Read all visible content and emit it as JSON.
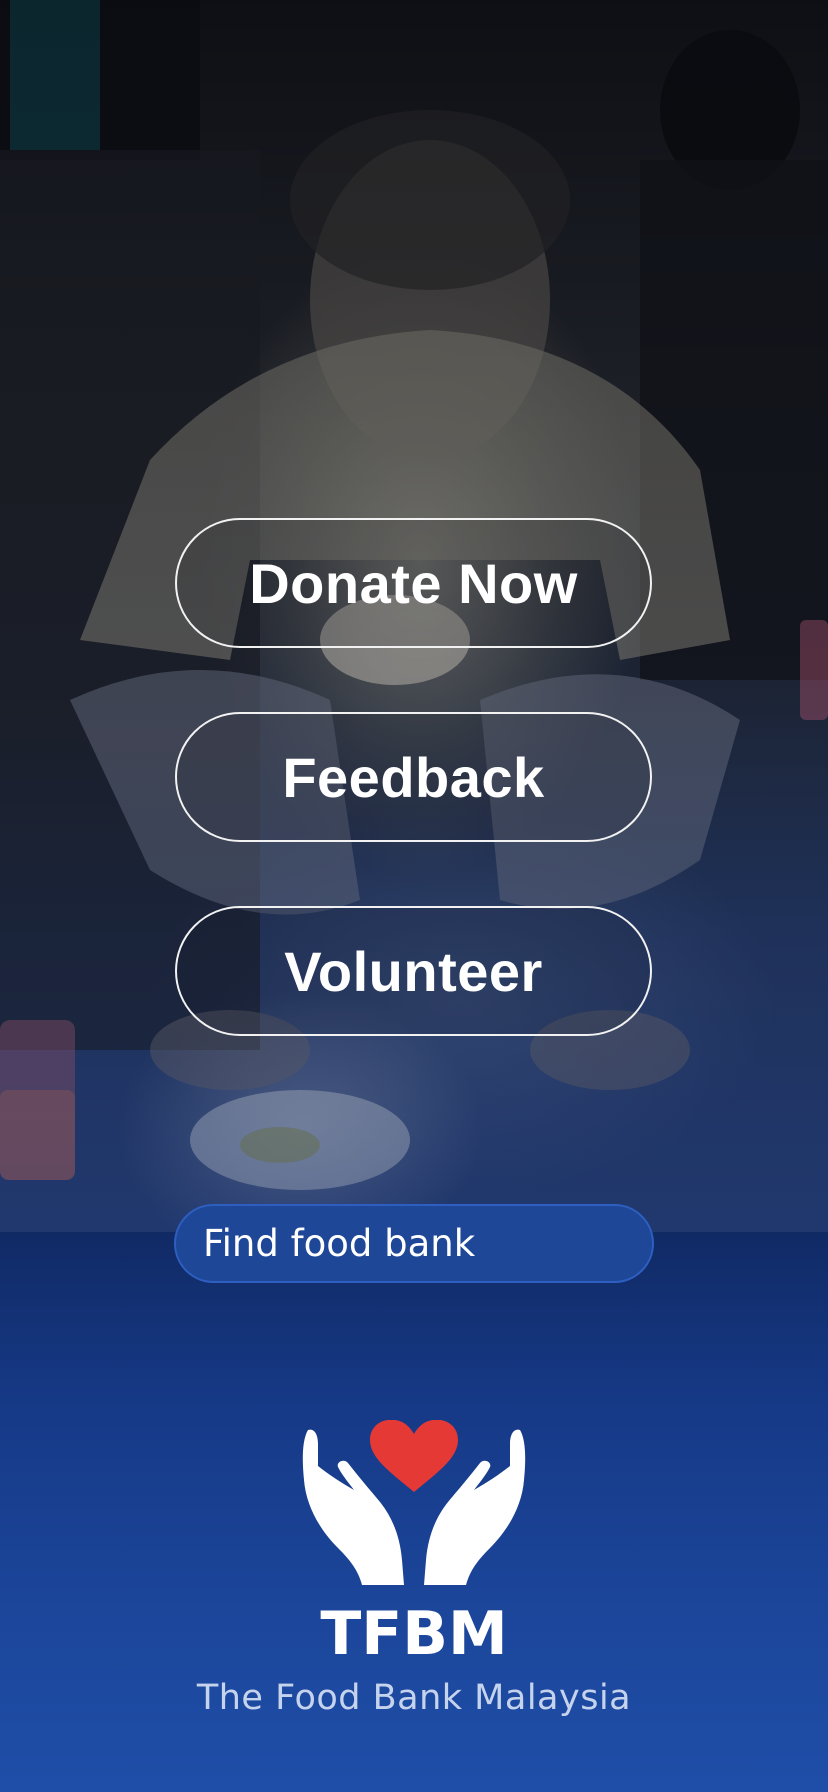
{
  "actions": {
    "donate_label": "Donate Now",
    "feedback_label": "Feedback",
    "volunteer_label": "Volunteer"
  },
  "search": {
    "placeholder": "Find food bank",
    "icon": "search-icon"
  },
  "brand": {
    "logo_icon": "heart-in-hands-icon",
    "name": "TFBM",
    "tagline": "The Food Bank Malaysia"
  },
  "colors": {
    "background_blue": "#1f4ea8",
    "heart_red": "#e53935",
    "button_border": "#f2f2f2",
    "search_bg": "#1e4798"
  }
}
